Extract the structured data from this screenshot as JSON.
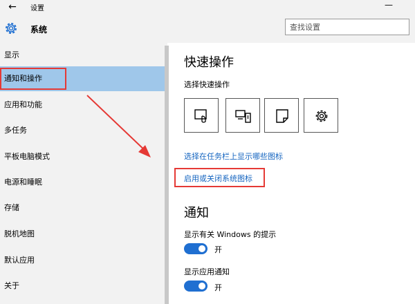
{
  "window": {
    "title": "设置"
  },
  "header": {
    "title": "系统",
    "search_placeholder": "查找设置"
  },
  "sidebar": {
    "items": [
      {
        "label": "显示"
      },
      {
        "label": "通知和操作"
      },
      {
        "label": "应用和功能"
      },
      {
        "label": "多任务"
      },
      {
        "label": "平板电脑模式"
      },
      {
        "label": "电源和睡眠"
      },
      {
        "label": "存储"
      },
      {
        "label": "脱机地图"
      },
      {
        "label": "默认应用"
      },
      {
        "label": "关于"
      }
    ],
    "active_index": 1
  },
  "main": {
    "quick_actions": {
      "title": "快速操作",
      "subtitle": "选择快速操作",
      "tiles": [
        {
          "icon": "tablet-mode-icon"
        },
        {
          "icon": "connect-display-icon"
        },
        {
          "icon": "note-icon"
        },
        {
          "icon": "settings-gear-icon"
        }
      ]
    },
    "links": {
      "taskbar_icons": "选择在任务栏上显示哪些图标",
      "system_icons": "启用或关闭系统图标"
    },
    "notifications": {
      "title": "通知",
      "windows_tips_label": "显示有关 Windows 的提示",
      "windows_tips_state": "开",
      "app_notifications_label": "显示应用通知",
      "app_notifications_state": "开"
    }
  },
  "colors": {
    "accent": "#1f6fd1",
    "active_nav": "#9fc7ea",
    "annotation_red": "#e53935",
    "link": "#1565c0"
  }
}
